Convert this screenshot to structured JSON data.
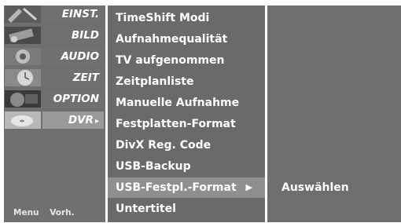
{
  "sidebar": {
    "categories": [
      {
        "label": "EINST.",
        "icon": "tools-thumbnail-icon"
      },
      {
        "label": "BILD",
        "icon": "film-reel-thumbnail-icon"
      },
      {
        "label": "AUDIO",
        "icon": "speaker-thumbnail-icon"
      },
      {
        "label": "ZEIT",
        "icon": "clock-thumbnail-icon"
      },
      {
        "label": "OPTION",
        "icon": "special-thumbnail-icon"
      },
      {
        "label": "DVR",
        "icon": "disc-thumbnail-icon",
        "active": true,
        "arrow": "▸"
      }
    ],
    "footer": {
      "menu": "Menu",
      "back": "Vorh."
    }
  },
  "submenu": {
    "items": [
      "TimeShift Modi",
      "Aufnahmequalität",
      "TV aufgenommen",
      "Zeitplanliste",
      "Manuelle Aufnahme",
      "Festplatten-Format",
      "DivX Reg. Code",
      "USB-Backup",
      "USB-Festpl.-Format",
      "Untertitel"
    ],
    "selected_index": 8,
    "selected_arrow": "▶"
  },
  "right_panel": {
    "option_label": "Auswählen"
  },
  "colors": {
    "panel": "#6e6e6e",
    "highlight": "#9a9a9a",
    "text": "#ffffff"
  }
}
